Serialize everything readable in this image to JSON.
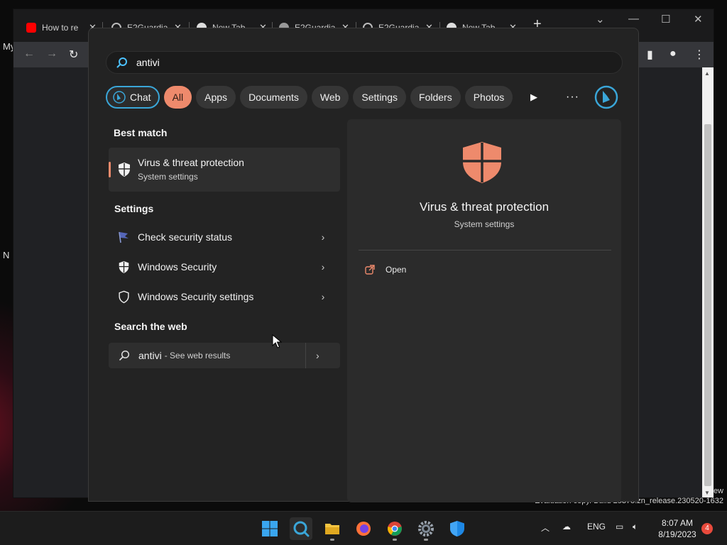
{
  "desktop": {
    "icon_labels": [
      "My",
      "N"
    ]
  },
  "browser": {
    "tabs": [
      {
        "title": "How to re",
        "favicon": "youtube-icon",
        "color": "#ff0000"
      },
      {
        "title": "E2Guardia",
        "favicon": "github-icon",
        "color": "#bbbbbb"
      },
      {
        "title": "New Tab",
        "favicon": "chrome-icon",
        "color": "#dddddd"
      },
      {
        "title": "E2Guardia",
        "favicon": "globe-icon",
        "color": "#bbbbbb"
      },
      {
        "title": "E2Guardia",
        "favicon": "github-icon",
        "color": "#bbbbbb"
      },
      {
        "title": "New Tab",
        "favicon": "chrome-icon",
        "color": "#dddddd"
      }
    ],
    "evaluation_text": "Evaluation copy. Build 25375.zn_release.230520-1632",
    "evaluation_text_top": "ew"
  },
  "search": {
    "query": "antivi",
    "filters": [
      {
        "label": "Chat",
        "key": "chat"
      },
      {
        "label": "All",
        "key": "all"
      },
      {
        "label": "Apps",
        "key": "apps"
      },
      {
        "label": "Documents",
        "key": "documents"
      },
      {
        "label": "Web",
        "key": "web"
      },
      {
        "label": "Settings",
        "key": "settings"
      },
      {
        "label": "Folders",
        "key": "folders"
      },
      {
        "label": "Photos",
        "key": "photos"
      }
    ],
    "active_filter": "All",
    "best_match_title": "Best match",
    "best_match": {
      "title": "Virus & threat protection",
      "subtitle": "System settings"
    },
    "settings_title": "Settings",
    "settings_items": [
      {
        "label": "Check security status",
        "icon": "flag-icon"
      },
      {
        "label": "Windows Security",
        "icon": "shield-filled-icon"
      },
      {
        "label": "Windows Security settings",
        "icon": "shield-outline-icon"
      }
    ],
    "web_title": "Search the web",
    "web_result": {
      "query": "antivi",
      "hint": "- See web results"
    },
    "preview": {
      "title": "Virus & threat protection",
      "subtitle": "System settings",
      "action_open": "Open"
    },
    "accent_color": "#ee8a6c"
  },
  "taskbar": {
    "apps": [
      "start-icon",
      "search-icon",
      "file-explorer-icon",
      "firefox-icon",
      "chrome-icon",
      "settings-icon",
      "windows-security-icon"
    ],
    "language": "ENG",
    "time": "8:07 AM",
    "date": "8/19/2023",
    "notification_count": "4"
  }
}
